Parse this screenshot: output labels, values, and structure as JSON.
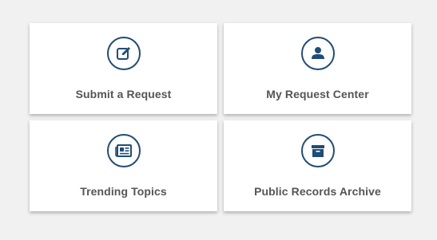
{
  "tiles": [
    {
      "label": "Submit a Request",
      "icon": "edit-icon"
    },
    {
      "label": "My Request Center",
      "icon": "user-icon"
    },
    {
      "label": "Trending Topics",
      "icon": "newspaper-icon"
    },
    {
      "label": "Public Records Archive",
      "icon": "archive-box-icon"
    }
  ],
  "colors": {
    "accent": "#1f4d78",
    "label": "#555555",
    "background": "#f1f1f1",
    "tile": "#ffffff"
  }
}
